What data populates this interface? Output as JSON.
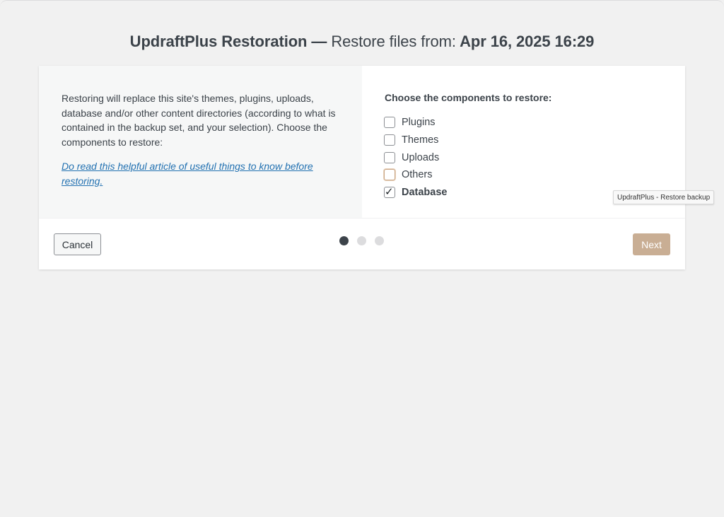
{
  "title": {
    "prefix": "UpdraftPlus Restoration — ",
    "main": "Restore files from:",
    "date": " Apr 16, 2025 16:29"
  },
  "left": {
    "description": "Restoring will replace this site's themes, plugins, uploads, database and/or other content directories (according to what is contained in the backup set, and your selection). Choose the components to restore:",
    "help_link": "Do read this helpful article of useful things to know before restoring."
  },
  "right": {
    "heading": "Choose the components to restore:",
    "components": [
      {
        "label": "Plugins",
        "checked": false
      },
      {
        "label": "Themes",
        "checked": false
      },
      {
        "label": "Uploads",
        "checked": false
      },
      {
        "label": "Others",
        "checked": false,
        "focused": true
      },
      {
        "label": "Database",
        "checked": true
      }
    ]
  },
  "footer": {
    "cancel_label": "Cancel",
    "next_label": "Next",
    "steps_total": 3,
    "current_step": 1
  },
  "tooltip": "UpdraftPlus - Restore backup",
  "colors": {
    "link": "#2271b1",
    "next_button": "#c9ae94",
    "active_dot": "#3c434a",
    "inactive_dot": "#dcdcde"
  }
}
